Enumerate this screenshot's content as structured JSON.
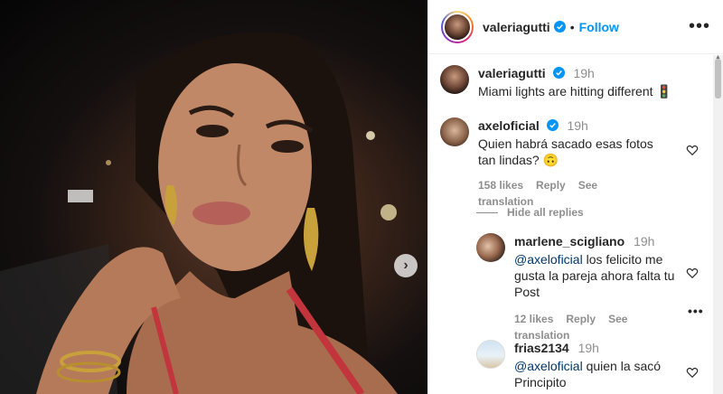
{
  "post": {
    "author": "valeriagutti",
    "follow_label": "Follow",
    "dot": "•",
    "more": "•••",
    "next_icon": "›"
  },
  "caption": {
    "user": "valeriagutti",
    "time": "19h",
    "text": "Miami lights are hitting different 🚦"
  },
  "comments": [
    {
      "user": "axeloficial",
      "verified": true,
      "time": "19h",
      "text": "Quien habrá sacado esas fotos tan lindas? 🙃",
      "likes": "158 likes",
      "reply": "Reply",
      "translate": "See translation"
    }
  ],
  "hide_replies": "Hide all replies",
  "replies": [
    {
      "user": "marlene_scigliano",
      "time": "19h",
      "mention": "@axeloficial",
      "text": " los felicito me gusta la pareja ahora falta tu Post",
      "likes": "12 likes",
      "reply": "Reply",
      "translate": "See translation",
      "more": "•••"
    },
    {
      "user": "frias2134",
      "time": "19h",
      "mention": "@axeloficial",
      "text": " quien la sacó Principito"
    }
  ],
  "colors": {
    "accent": "#0095f6",
    "verified": "#0095f6",
    "muted": "#8e8e8e"
  }
}
